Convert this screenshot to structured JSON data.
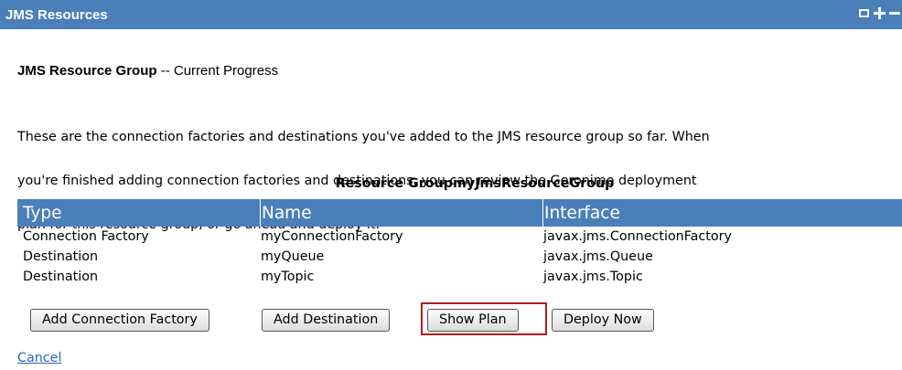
{
  "portlet": {
    "title": "JMS Resources"
  },
  "heading": {
    "strong": "JMS Resource Group",
    "rest": " -- Current Progress"
  },
  "intro_lines": [
    "These are the connection factories and destinations you've added to the JMS resource group so far. When",
    "you're finished adding connection factories and destinations, you can review the Geronimo deployment",
    "plan for this resource group, or go ahead and deploy it."
  ],
  "resource_group_title": "Resource GroupmyJmsResourceGroup",
  "table": {
    "columns": [
      "Type",
      "Name",
      "Interface"
    ],
    "rows": [
      [
        "Connection Factory",
        "myConnectionFactory",
        "javax.jms.ConnectionFactory"
      ],
      [
        "Destination",
        "myQueue",
        "javax.jms.Queue"
      ],
      [
        "Destination",
        "myTopic",
        "javax.jms.Topic"
      ]
    ]
  },
  "buttons": {
    "add_connection_factory": "Add Connection Factory",
    "add_destination": "Add Destination",
    "show_plan": "Show Plan",
    "deploy_now": "Deploy Now"
  },
  "cancel_link": "Cancel",
  "colors": {
    "header_blue": "#4a7fb9",
    "link_blue": "#2a63b6",
    "highlight_red": "#b21c1c"
  },
  "icons": [
    "maximize-icon",
    "add-icon",
    "minimize-icon"
  ]
}
